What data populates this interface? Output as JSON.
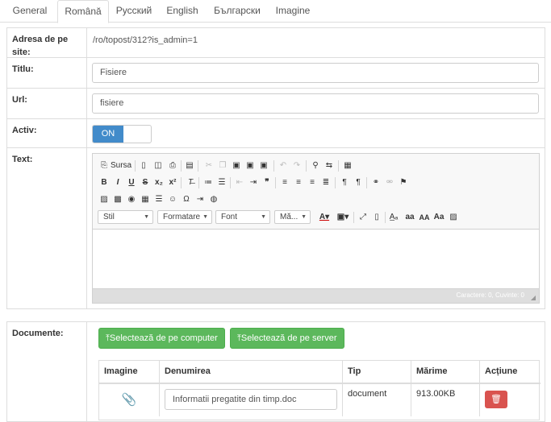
{
  "tabs": [
    "General",
    "Română",
    "Русский",
    "English",
    "Български",
    "Imagine"
  ],
  "form": {
    "site_address_label": "Adresa de pe site:",
    "site_address_value": "/ro/topost/312?is_admin=1",
    "title_label": "Titlu:",
    "title_value": "Fisiere",
    "url_label": "Url:",
    "url_value": "fisiere",
    "active_label": "Activ:",
    "active_state": "ON",
    "text_label": "Text:"
  },
  "editor": {
    "source_label": "Sursa",
    "combos": [
      "Stil",
      "Formatare",
      "Font",
      "Mă..."
    ],
    "status": "Caractere: 0, Cuvinte: 0"
  },
  "documents": {
    "label": "Documente:",
    "upload_computer": "Selectează de pe computer",
    "upload_server": "Selectează de pe server",
    "columns": [
      "Imagine",
      "Denumirea",
      "Tip",
      "Mărime",
      "Acțiune"
    ],
    "rows": [
      {
        "name": "Informatii pregatite din timp.doc",
        "type": "document",
        "size": "913.00KB"
      }
    ]
  },
  "colors": {
    "primary": "#428bca",
    "success": "#5cb85c",
    "danger": "#d9534f"
  }
}
